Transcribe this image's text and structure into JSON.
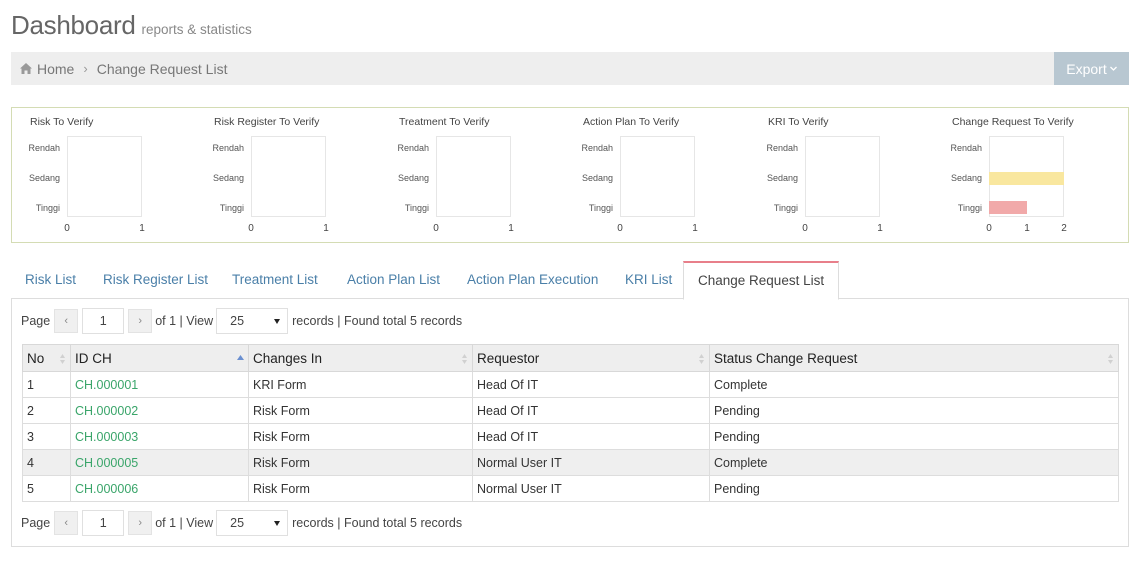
{
  "header": {
    "title": "Dashboard",
    "subtitle": "reports & statistics"
  },
  "breadcrumb": {
    "home": "Home",
    "current": "Change Request List"
  },
  "export_button": {
    "label": "Export"
  },
  "chart_data": [
    {
      "type": "bar",
      "title": "Risk To Verify",
      "categories": [
        "Rendah",
        "Sedang",
        "Tinggi"
      ],
      "values": [
        0,
        0,
        0
      ],
      "xticks": [
        "0",
        "1"
      ],
      "xlim": [
        0,
        1
      ]
    },
    {
      "type": "bar",
      "title": "Risk Register To Verify",
      "categories": [
        "Rendah",
        "Sedang",
        "Tinggi"
      ],
      "values": [
        0,
        0,
        0
      ],
      "xticks": [
        "0",
        "1"
      ],
      "xlim": [
        0,
        1
      ]
    },
    {
      "type": "bar",
      "title": "Treatment To Verify",
      "categories": [
        "Rendah",
        "Sedang",
        "Tinggi"
      ],
      "values": [
        0,
        0,
        0
      ],
      "xticks": [
        "0",
        "1"
      ],
      "xlim": [
        0,
        1
      ]
    },
    {
      "type": "bar",
      "title": "Action Plan To Verify",
      "categories": [
        "Rendah",
        "Sedang",
        "Tinggi"
      ],
      "values": [
        0,
        0,
        0
      ],
      "xticks": [
        "0",
        "1"
      ],
      "xlim": [
        0,
        1
      ]
    },
    {
      "type": "bar",
      "title": "KRI To Verify",
      "categories": [
        "Rendah",
        "Sedang",
        "Tinggi"
      ],
      "values": [
        0,
        0,
        0
      ],
      "xticks": [
        "0",
        "1"
      ],
      "xlim": [
        0,
        1
      ]
    },
    {
      "type": "bar",
      "title": "Change Request To Verify",
      "categories": [
        "Rendah",
        "Sedang",
        "Tinggi"
      ],
      "values": [
        0,
        2,
        1
      ],
      "colors": [
        "#f9e79f",
        "#f9e79f",
        "#f1a9a9"
      ],
      "xticks": [
        "0",
        "1",
        "2"
      ],
      "xlim": [
        0,
        2
      ]
    }
  ],
  "tabs": [
    "Risk List",
    "Risk Register List",
    "Treatment List",
    "Action Plan List",
    "Action Plan Execution",
    "KRI List",
    "Change Request List"
  ],
  "active_tab": "Change Request List",
  "pager": {
    "page_label": "Page",
    "prev": "‹",
    "next": "›",
    "page": "1",
    "of_label": "of 1 | View",
    "view": "25",
    "records_label": "records | Found total 5 records"
  },
  "table": {
    "columns": [
      "No",
      "ID CH",
      "Changes In",
      "Requestor",
      "Status Change Request"
    ],
    "rows": [
      [
        "1",
        "CH.000001",
        "KRI Form",
        "Head Of IT",
        "Complete"
      ],
      [
        "2",
        "CH.000002",
        "Risk Form",
        "Head Of IT",
        "Pending"
      ],
      [
        "3",
        "CH.000003",
        "Risk Form",
        "Head Of IT",
        "Pending"
      ],
      [
        "4",
        "CH.000005",
        "Risk Form",
        "Normal User IT",
        "Complete"
      ],
      [
        "5",
        "CH.000006",
        "Risk Form",
        "Normal User IT",
        "Pending"
      ]
    ]
  },
  "colors": {
    "link": "#3aa56a",
    "tab_link": "#4a7fa8",
    "active_tab_border": "#e87f8a",
    "export_bg": "#b8c7d1"
  }
}
